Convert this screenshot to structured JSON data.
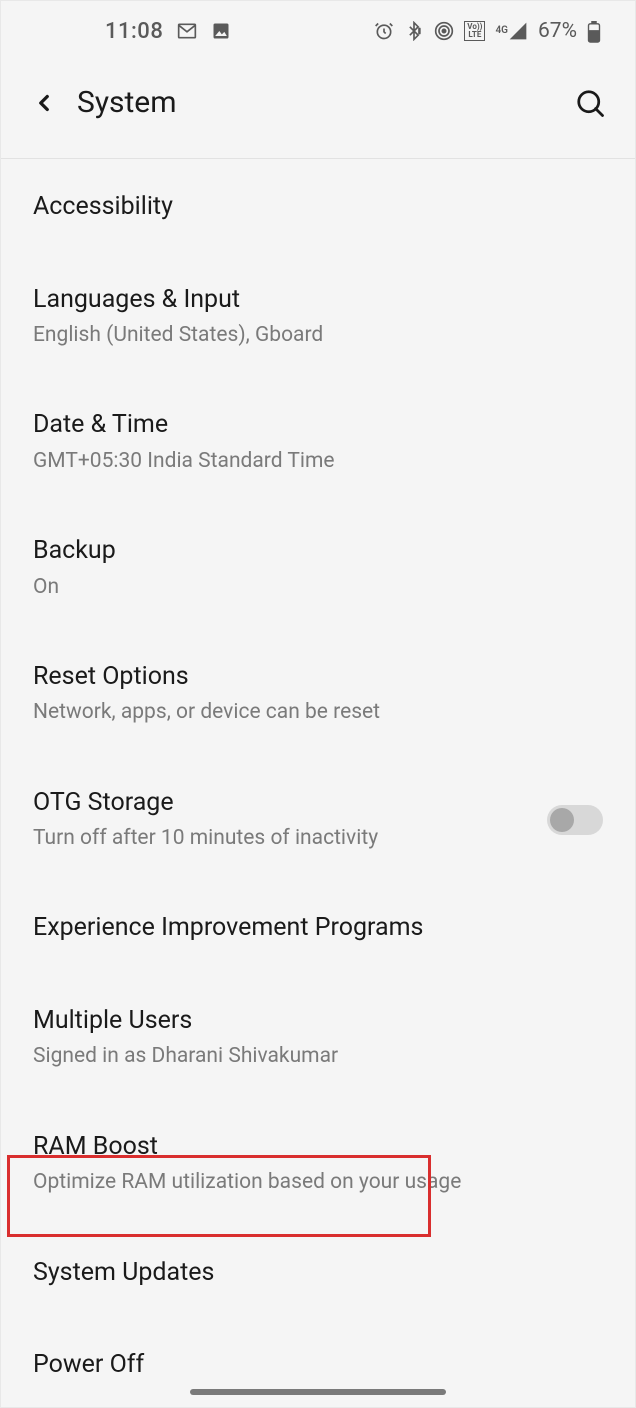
{
  "statusBar": {
    "time": "11:08",
    "battery": "67%"
  },
  "header": {
    "title": "System"
  },
  "items": [
    {
      "title": "Accessibility",
      "subtitle": ""
    },
    {
      "title": "Languages & Input",
      "subtitle": "English (United States), Gboard"
    },
    {
      "title": "Date & Time",
      "subtitle": "GMT+05:30 India Standard Time"
    },
    {
      "title": "Backup",
      "subtitle": "On"
    },
    {
      "title": "Reset Options",
      "subtitle": "Network, apps, or device can be reset"
    },
    {
      "title": "OTG Storage",
      "subtitle": "Turn off after 10 minutes of inactivity"
    },
    {
      "title": "Experience Improvement Programs",
      "subtitle": ""
    },
    {
      "title": "Multiple Users",
      "subtitle": "Signed in as Dharani Shivakumar"
    },
    {
      "title": "RAM Boost",
      "subtitle": "Optimize RAM utilization based on your usage"
    },
    {
      "title": "System Updates",
      "subtitle": ""
    },
    {
      "title": "Power Off",
      "subtitle": ""
    }
  ],
  "signal": {
    "netLabel": "4G"
  },
  "volte": {
    "line1": "Vo))",
    "line2": "LTE"
  }
}
